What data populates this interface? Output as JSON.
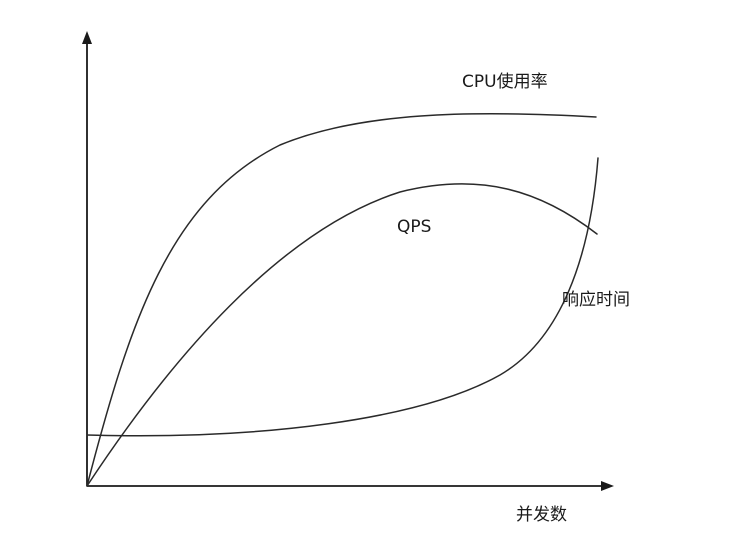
{
  "labels": {
    "cpu": "CPU使用率",
    "qps": "QPS",
    "response_time": "响应时间",
    "x_axis": "并发数"
  }
}
